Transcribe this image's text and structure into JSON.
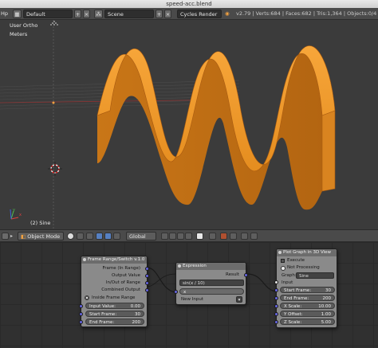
{
  "window": {
    "title": "speed-acc.blend"
  },
  "infobar": {
    "menu_fragment": "Hp",
    "screen_layout": "Default",
    "scene": "Scene",
    "render_engine": "Cycles Render",
    "stats": "v2.79 | Verts:684 | Faces:682 | Tris:1,364 | Objects:0/4"
  },
  "viewport": {
    "view_name": "User Ortho",
    "units": "Meters",
    "object_label": "(2) Sine",
    "axis_x": "x",
    "axis_y": "y",
    "object_color": "#f39a2a"
  },
  "view_header": {
    "mode": "Object Mode",
    "pivot": "Global"
  },
  "nodes": {
    "frame_range": {
      "title": "Frame Range/Switch v.1.0",
      "outputs": [
        "Frame (In Range)",
        "Output Value",
        "In/Out of Range",
        "Combined Output"
      ],
      "inside_label": "Inside Frame Range",
      "fields": [
        {
          "label": "Input Value:",
          "value": "0.00"
        },
        {
          "label": "Start Frame:",
          "value": "30"
        },
        {
          "label": "End Frame:",
          "value": "200"
        }
      ]
    },
    "expression": {
      "title": "Expression",
      "output": "Result",
      "expression": "sin(x / 10)",
      "var_name": "x",
      "new_input": "New Input"
    },
    "plot_graph": {
      "title": "Plot Graph in 3D View",
      "execute": "Execute",
      "status": "Not Processing",
      "graph_label": "Graph:",
      "graph_value": "Sine",
      "input_label": "Input",
      "fields": [
        {
          "label": "Start Frame:",
          "value": "30"
        },
        {
          "label": "End Frame:",
          "value": "200"
        },
        {
          "label": "X Scale:",
          "value": "10.00"
        },
        {
          "label": "Y Offset:",
          "value": "1.00"
        },
        {
          "label": "Z Scale:",
          "value": "5.00"
        }
      ]
    }
  }
}
